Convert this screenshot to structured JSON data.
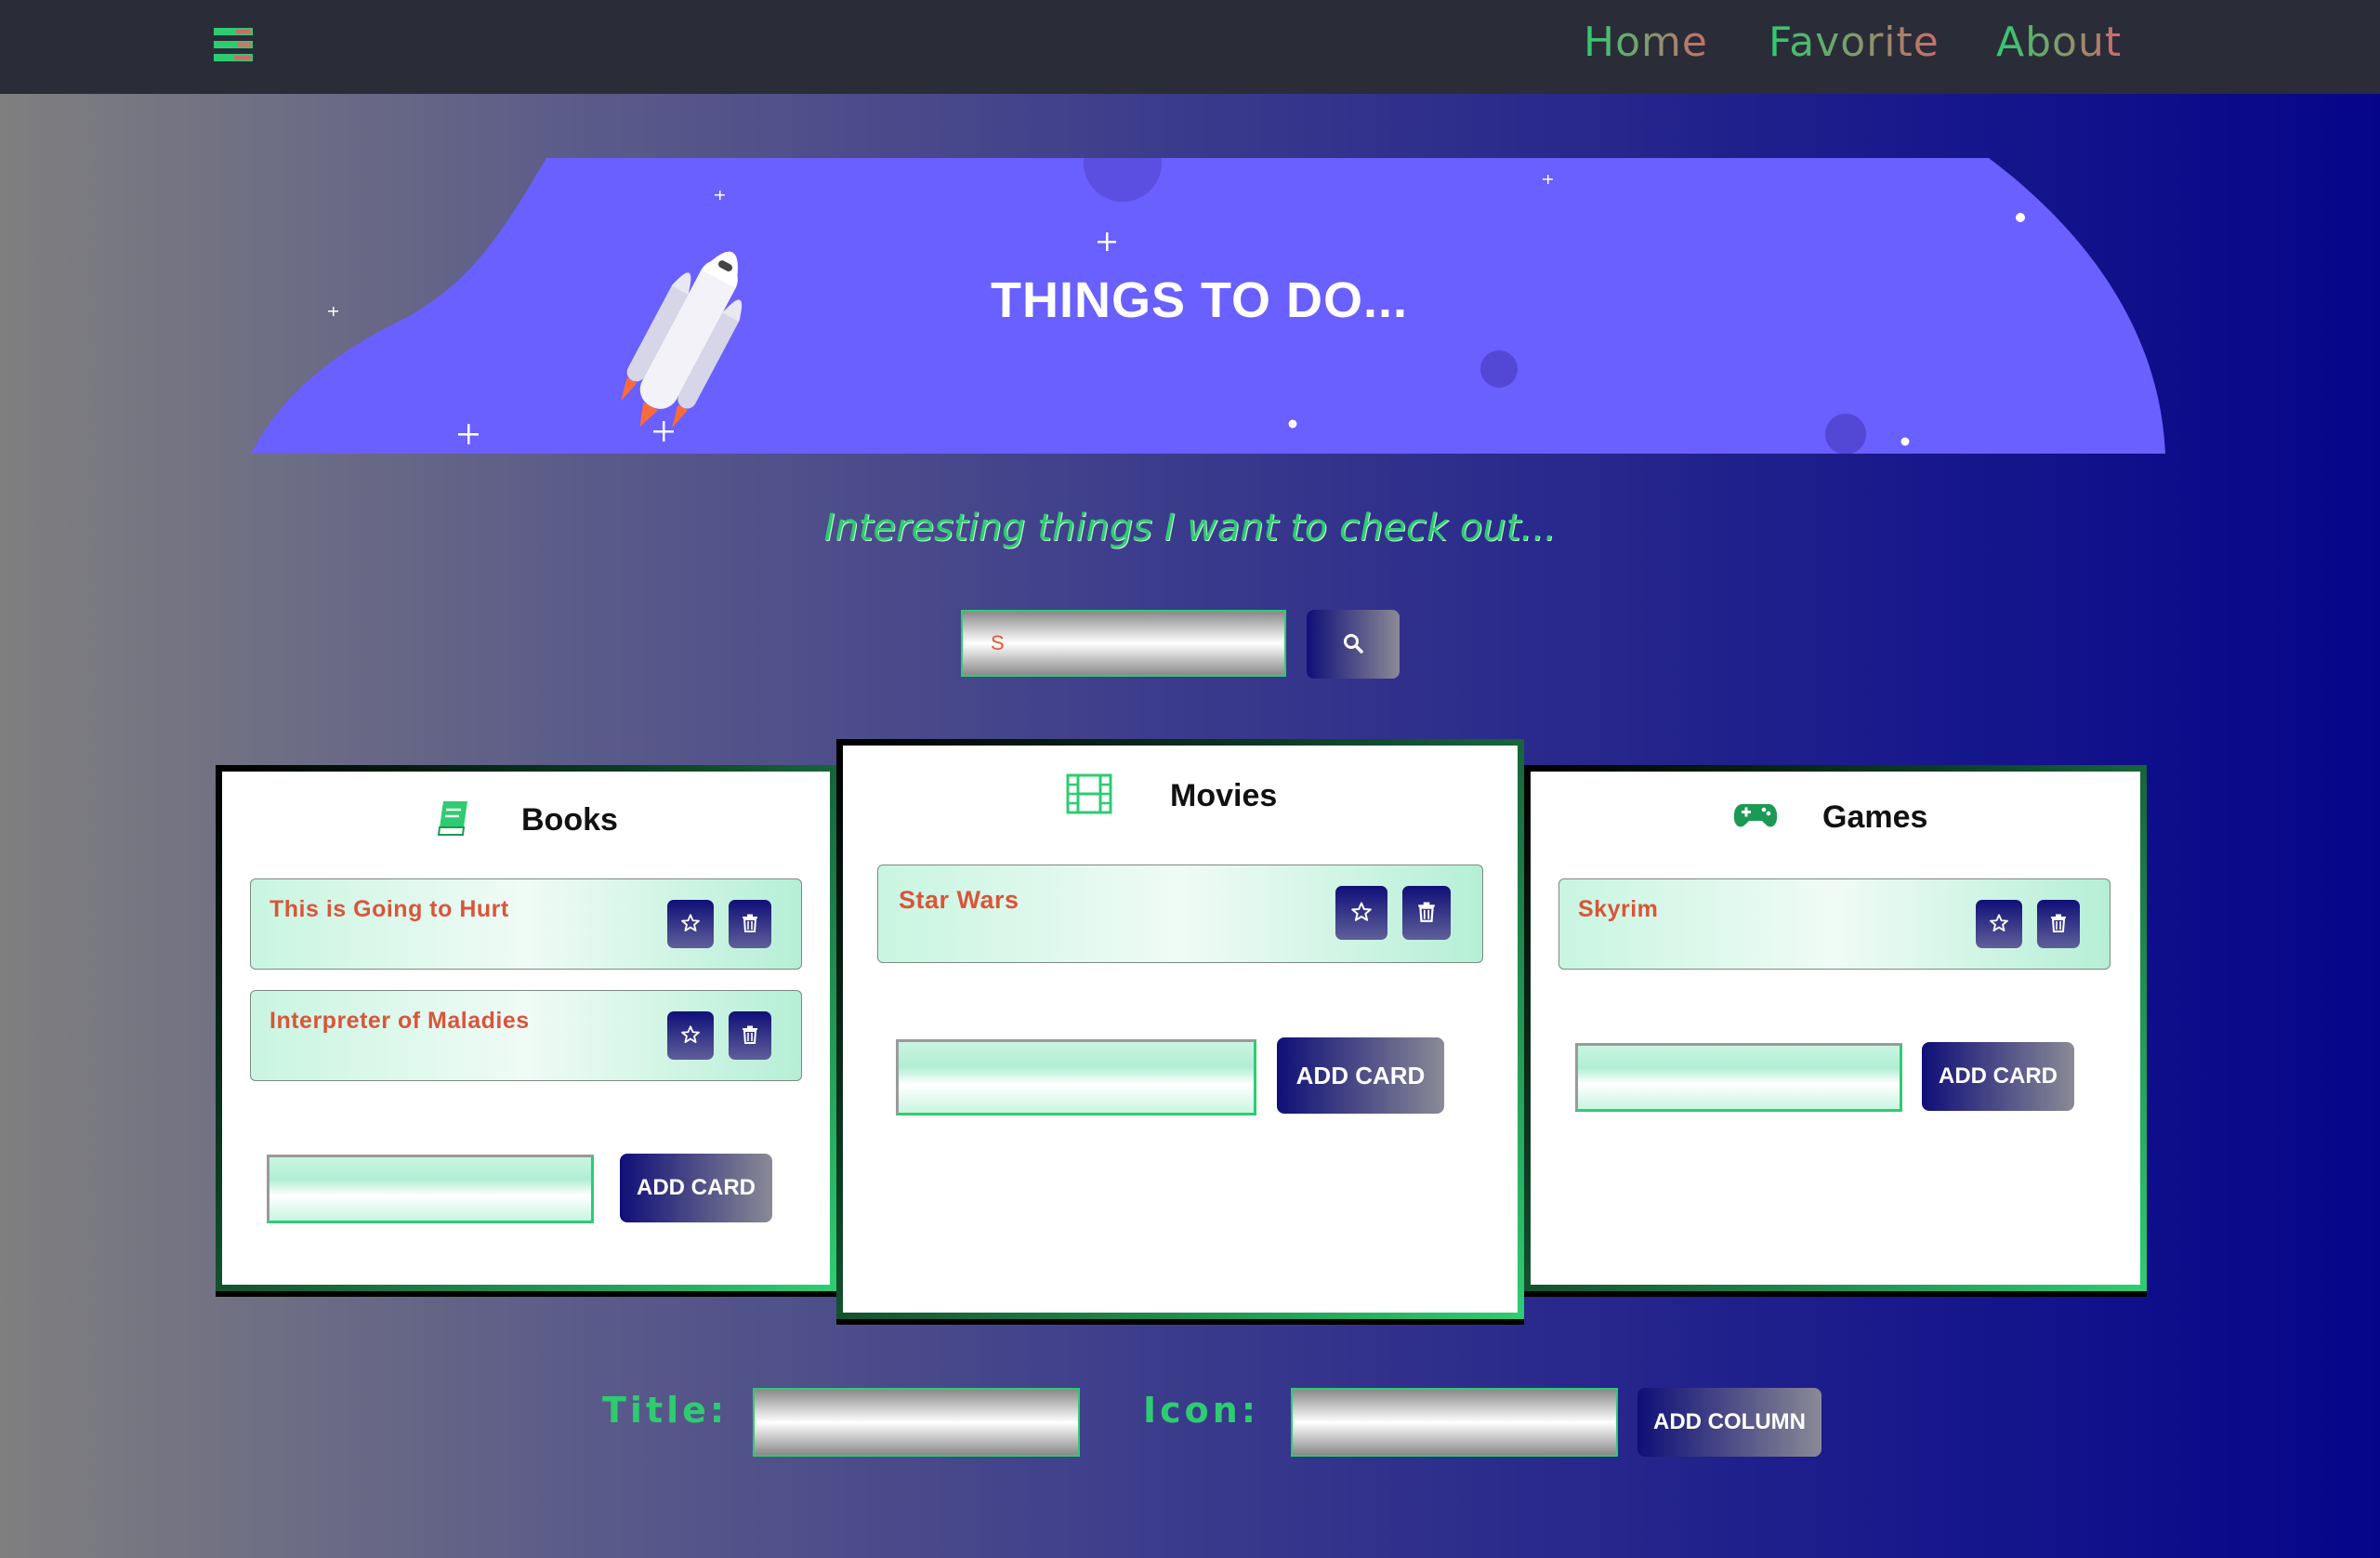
{
  "nav": {
    "home": "Home",
    "favorite": "Favorite",
    "about": "About"
  },
  "hero": {
    "title": "THINGS TO DO..."
  },
  "subtitle": "Interesting things I want to check out...",
  "search": {
    "value": "S"
  },
  "columns": [
    {
      "title": "Books",
      "icon": "book-icon",
      "cards": [
        "This is Going to Hurt",
        "Interpreter of Maladies"
      ],
      "add_label": "ADD CARD"
    },
    {
      "title": "Movies",
      "icon": "film-icon",
      "cards": [
        "Star Wars"
      ],
      "add_label": "ADD CARD"
    },
    {
      "title": "Games",
      "icon": "gamepad-icon",
      "cards": [
        "Skyrim"
      ],
      "add_label": "ADD CARD"
    }
  ],
  "new_column": {
    "title_label": "Title:",
    "icon_label": "Icon:",
    "add_label": "ADD COLUMN"
  },
  "colors": {
    "accent_green": "#2ecc71",
    "card_text": "#d9553a",
    "button_navy": "#0f0f78",
    "hero_purple": "#6a5fff",
    "navbar": "#2a2d38"
  }
}
